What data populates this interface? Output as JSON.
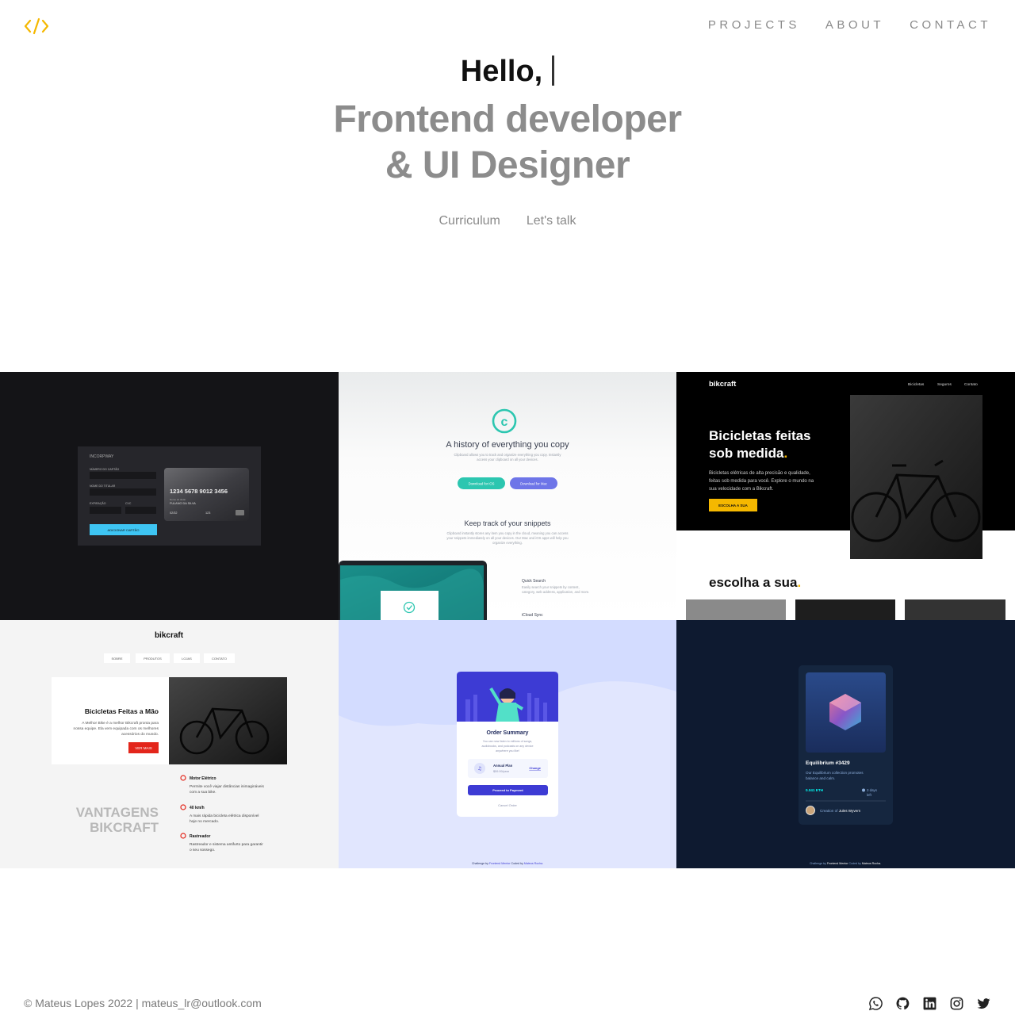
{
  "header": {
    "logo_icon": "code-brackets-icon",
    "accent_color": "#f5b800",
    "nav": [
      {
        "label": "PROJECTS"
      },
      {
        "label": "ABOUT"
      },
      {
        "label": "CONTACT"
      }
    ]
  },
  "hero": {
    "greeting": "Hello,",
    "role_line1": "Frontend developer",
    "role_line2": "& UI Designer",
    "curriculum_label": "Curriculum",
    "talk_label": "Let's talk"
  },
  "projects": [
    {
      "brand": "INCORPWAY",
      "card_number": "1234 5678 9012 3456",
      "card_holder_label": "Nome do titular",
      "card_holder": "FULANO DA SILVA",
      "expiry": "02/32",
      "cvc": "123",
      "field_number": "NÚMERO DO CARTÃO",
      "field_name": "NOME DO TITULAR",
      "field_expiry": "EXPIRAÇÃO",
      "field_cvc": "CVC",
      "button": "ADICIONAR CARTÃO"
    },
    {
      "title": "A history of everything you copy",
      "subtitle1": "Clipboard allows you to track and organize everything you copy. Instantly",
      "subtitle2": "access your clipboard on all your devices.",
      "btn_ios": "Download for iOS",
      "btn_mac": "Download for Mac",
      "section_title": "Keep track of your snippets",
      "section_text1": "Clipboard instantly stores any item you copy in the cloud, meaning you can access",
      "section_text2": "your snippets immediately on all your devices. Our Mac and iOS apps will help you",
      "section_text3": "organize everything.",
      "feature1": "Quick Search",
      "feature1_text1": "Easily search your snippets by content,",
      "feature1_text2": "category, web address, application, and more.",
      "feature2": "iCloud Sync"
    },
    {
      "brand": "bikcraft",
      "nav": [
        "Bicicletas",
        "Seguros",
        "Contato"
      ],
      "headline1": "Bicicletas feitas",
      "headline2": "sob medida",
      "dot": ".",
      "text1": "Bicicletas elétricas de alta precisão e qualidade,",
      "text2": "feitas sob medida para você. Explore o mundo na",
      "text3": "sua velocidade com a Bikcraft.",
      "button": "ESCOLHA A SUA",
      "section": "escolha a sua"
    },
    {
      "brand": "bikcraft",
      "nav": [
        "SOBRE",
        "PRODUTOS",
        "LOJAS",
        "CONTATO"
      ],
      "headline": "Bicicletas Feitas a Mão",
      "text1": "A Melhor Bike é a melhor Bikcraft pronta para",
      "text2": "nossa equipe. Ela vem equipada com os melhores",
      "text3": "acessórios do mundo.",
      "button": "VER MAIS",
      "vantagens1": "VANTAGENS",
      "vantagens2": "BIKCRAFT",
      "f1_title": "Motor Elétrico",
      "f1_text1": "Permite você viajar distâncias inimagináveis",
      "f1_text2": "com a sua bike.",
      "f2_title": "40 km/h",
      "f2_text1": "A mais rápida bicicleta elétrica disponível",
      "f2_text2": "hoje no mercado.",
      "f3_title": "Rastreador",
      "f3_text1": "Rastreador e sistema antifurto para garantir",
      "f3_text2": "o seu sossego."
    },
    {
      "title": "Order Summary",
      "text1": "You can now listen to millions of songs,",
      "text2": "audiobooks, and podcasts on any device",
      "text3": "anywhere you like!",
      "plan": "Annual Plan",
      "price": "$59.99/year",
      "change": "Change",
      "proceed": "Proceed to Payment",
      "cancel": "Cancel Order",
      "credit_a": "Challenge by",
      "credit_b": "Frontend Mentor",
      "credit_c": "Coded by",
      "credit_d": "Mateus Rocha."
    },
    {
      "title": "Equilibrium #3429",
      "text1": "Our Equilibrium collection promotes",
      "text2": "balance and calm.",
      "eth": "0.041 ETH",
      "days1": "3 days",
      "days2": "left",
      "creation": "Creation of",
      "creator": "Jules Wyvern",
      "credit_a": "Challenge by",
      "credit_b": "Frontend Mentor",
      "credit_c": "Coded by",
      "credit_d": "Mateus Rocha."
    }
  ],
  "footer": {
    "text": "© Mateus Lopes 2022 | mateus_lr@outlook.com",
    "social": [
      "whatsapp-icon",
      "github-icon",
      "linkedin-icon",
      "instagram-icon",
      "twitter-icon"
    ]
  }
}
